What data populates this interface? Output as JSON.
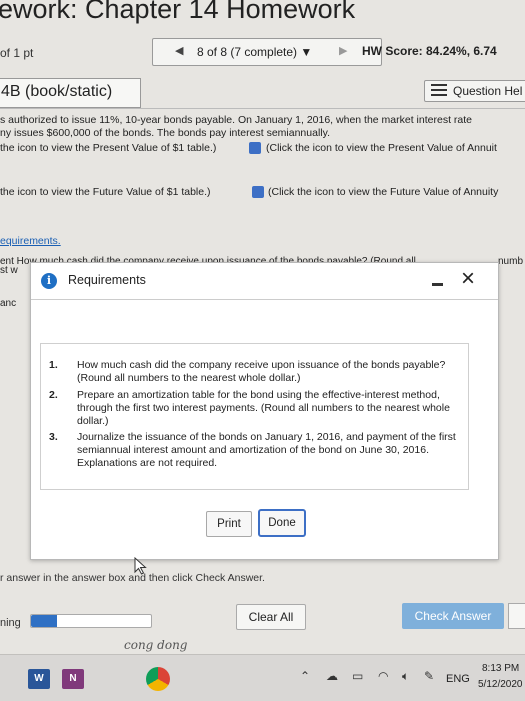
{
  "header": {
    "title": "ework: Chapter 14 Homework",
    "points": "of 1 pt",
    "nav_count": "8 of 8 (7 complete)",
    "hw_score": "HW Score: 84.24%, 6.74",
    "section": "4B (book/static)",
    "question_help": "Question Hel"
  },
  "problem": {
    "line1": "s authorized to issue 11%, 10-year bonds payable. On January 1, 2016, when the market interest rate",
    "line2": "ny issues $600,000 of the bonds. The bonds pay interest semiannually.",
    "line3a": "the icon to view the Present Value of $1 table.)",
    "line3b": "(Click the icon to view the Present Value of Annuit",
    "line4a": "the icon to view the Future Value of $1 table.)",
    "line4b": "(Click the icon to view the Future Value of Annuity",
    "requirements_link": "equirements."
  },
  "behind": {
    "line1": "ent  How much cash did the company receive upon issuance of the bonds payable? (Round all",
    "right": "numb",
    "line2": "st w",
    "line3": "anc"
  },
  "dialog": {
    "title": "Requirements",
    "close_label": "×",
    "items": [
      {
        "num": "1.",
        "text": "How much cash did the company receive upon issuance of the bonds payable? (Round all numbers to the nearest whole dollar.)"
      },
      {
        "num": "2.",
        "text": "Prepare an amortization table for the bond using the effective-interest method, through the first two interest payments. (Round all numbers to the nearest whole dollar.)"
      },
      {
        "num": "3.",
        "text": "Journalize the issuance of the bonds on January 1, 2016, and payment of the first semiannual interest amount and amortization of the bond on June 30, 2016. Explanations are not required."
      }
    ],
    "print_label": "Print",
    "done_label": "Done"
  },
  "footer": {
    "answer_hint": "r answer in the answer box and then click Check Answer.",
    "remaining_label": "ning",
    "progress_fraction": 0.22,
    "clear_all": "Clear All",
    "check_answer": "Check Answer",
    "handwriting": "cong dong"
  },
  "taskbar": {
    "lang": "ENG",
    "time": "8:13 PM",
    "date": "5/12/2020",
    "word_label": "W",
    "onenote_label": "N"
  },
  "colors": {
    "accent": "#2f70c4",
    "check_answer_bg": "#7fb0db",
    "link": "#1a5fb4"
  }
}
